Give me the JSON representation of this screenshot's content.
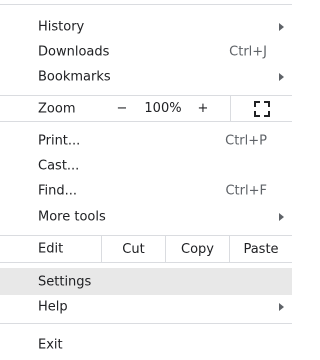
{
  "menu": {
    "history": {
      "label": "History"
    },
    "downloads": {
      "label": "Downloads",
      "shortcut": "Ctrl+J"
    },
    "bookmarks": {
      "label": "Bookmarks"
    },
    "zoom": {
      "label": "Zoom",
      "minus": "−",
      "value": "100%",
      "plus": "+"
    },
    "print": {
      "label": "Print...",
      "shortcut": "Ctrl+P"
    },
    "cast": {
      "label": "Cast..."
    },
    "find": {
      "label": "Find...",
      "shortcut": "Ctrl+F"
    },
    "more_tools": {
      "label": "More tools"
    },
    "edit": {
      "label": "Edit",
      "cut": "Cut",
      "copy": "Copy",
      "paste": "Paste"
    },
    "settings": {
      "label": "Settings"
    },
    "help": {
      "label": "Help"
    },
    "exit": {
      "label": "Exit"
    }
  }
}
